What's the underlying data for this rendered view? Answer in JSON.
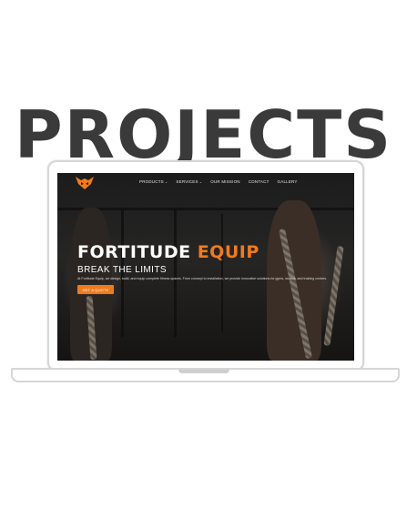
{
  "page": {
    "heading": "PROJECTS"
  },
  "website": {
    "nav": {
      "logo_icon": "fox-logo-icon",
      "items": [
        {
          "label": "PRODUCTS",
          "has_dropdown": true
        },
        {
          "label": "SERVICES",
          "has_dropdown": true
        },
        {
          "label": "OUR MISSION",
          "has_dropdown": false
        },
        {
          "label": "CONTACT",
          "has_dropdown": false
        },
        {
          "label": "GALLERY",
          "has_dropdown": false
        }
      ],
      "dropdown_glyph": "⌄"
    },
    "hero": {
      "title_main": "FORTITUDE",
      "title_accent": "EQUIP",
      "subtitle": "BREAK THE LIMITS",
      "description": "At Fortitude Equip, we design, build, and equip complete fitness spaces. From concept to installation, we provide innovative solutions for gyms, studios, and training centres.",
      "cta_label": "GET A QUOTE"
    },
    "colors": {
      "accent": "#f07b1d",
      "background": "#1a1a1a",
      "heading": "#3a3a3a"
    }
  }
}
